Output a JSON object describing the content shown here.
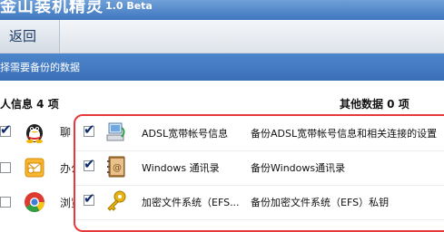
{
  "app": {
    "title": "金山装机精灵",
    "version": "1.0 Beta"
  },
  "toolbar": {
    "back_label": "返回"
  },
  "instruction": "择需要备份的数据",
  "left_section": {
    "header": "人信息 4 项",
    "items": [
      {
        "label": "聊",
        "checked": true,
        "icon": "qq-icon"
      },
      {
        "label": "办公",
        "checked": false,
        "icon": "outlook-icon"
      },
      {
        "label": "浏览",
        "checked": false,
        "icon": "chrome-icon"
      }
    ]
  },
  "right_section": {
    "header": "其他数据 0 项",
    "items": [
      {
        "name": "ADSL宽带帐号信息",
        "description": "备份ADSL宽带帐号信息和相关连接的设置",
        "checked": true,
        "icon": "network-icon"
      },
      {
        "name": "Windows 通讯录",
        "description": "备份Windows通讯录",
        "checked": true,
        "icon": "address-book-icon"
      },
      {
        "name": "加密文件系统（EFS...",
        "description": "备份加密文件系统（EFS）私钥",
        "checked": true,
        "icon": "key-icon"
      }
    ]
  },
  "colors": {
    "title_bar": "#3e76bf",
    "sub_bar": "#4579c0",
    "highlight_border": "#e63a3a"
  }
}
